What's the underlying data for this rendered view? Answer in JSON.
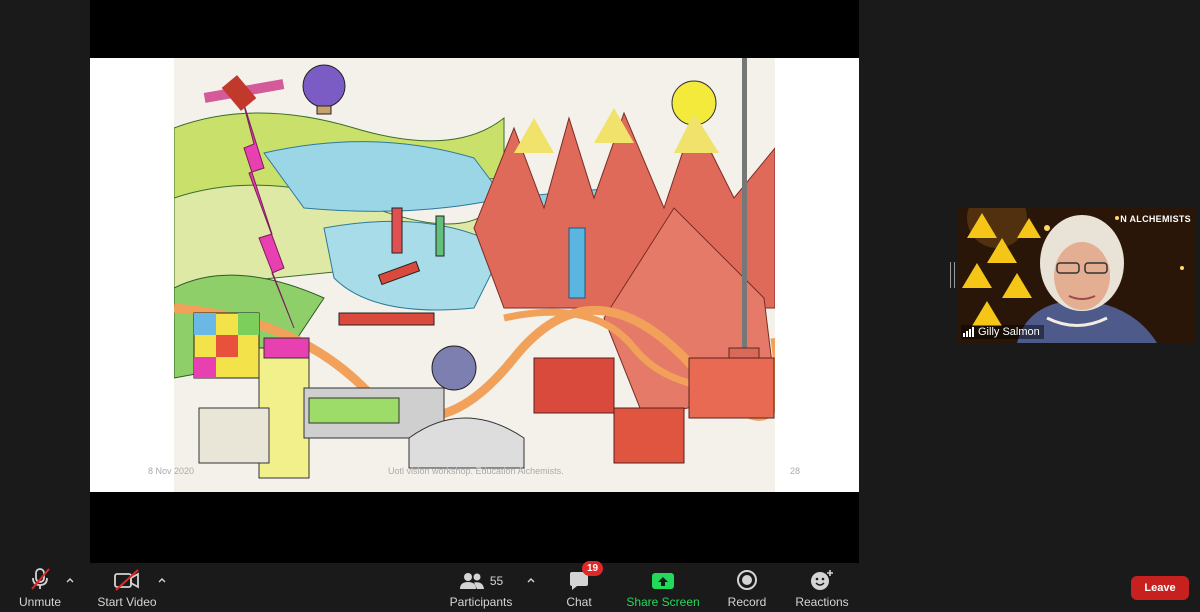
{
  "slide": {
    "date": "8 Nov 2020",
    "footer_text": "Uotl vision workshop. Education Alchemists.",
    "page_number": "28"
  },
  "speaker_tile": {
    "banner": "N ALCHEMISTS",
    "name": "Gilly Salmon"
  },
  "toolbar": {
    "unmute_label": "Unmute",
    "start_video_label": "Start Video",
    "participants_label": "Participants",
    "participants_count": "55",
    "chat_label": "Chat",
    "chat_badge": "19",
    "share_screen_label": "Share Screen",
    "record_label": "Record",
    "reactions_label": "Reactions",
    "leave_label": "Leave"
  },
  "colors": {
    "background": "#1a1a1a",
    "share_green": "#23d959",
    "leave_red": "#c7211f",
    "badge_red": "#e02828",
    "mute_slash": "#e02828"
  }
}
